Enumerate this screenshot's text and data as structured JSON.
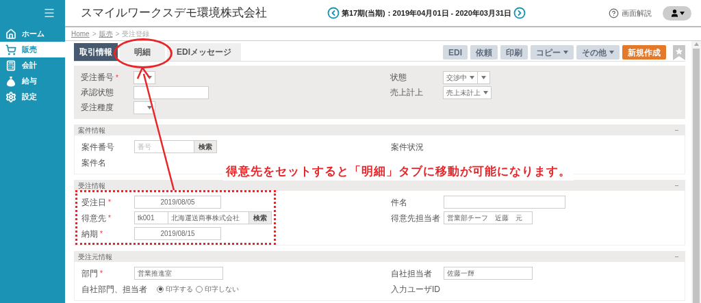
{
  "sidebar": {
    "items": [
      {
        "label": "ホーム",
        "selected": false
      },
      {
        "label": "販売",
        "selected": true
      },
      {
        "label": "会計",
        "selected": false
      },
      {
        "label": "給与",
        "selected": false
      },
      {
        "label": "設定",
        "selected": false
      }
    ]
  },
  "header": {
    "company": "スマイルワークスデモ環境株式会社",
    "period": "第17期(当期)：2019年04月01日 - 2020年03月31日",
    "help": "画面解説"
  },
  "breadcrumb": [
    {
      "label": "Home",
      "kind": "link"
    },
    {
      "label": ">",
      "kind": "separator"
    },
    {
      "label": "販売",
      "kind": "link"
    },
    {
      "label": ">",
      "kind": "separator"
    },
    {
      "label": "受注登録",
      "kind": "current"
    }
  ],
  "tabs": [
    {
      "label": "取引情報",
      "selected": true
    },
    {
      "label": "明細",
      "selected": false
    },
    {
      "label": "EDIメッセージ",
      "selected": false
    }
  ],
  "toolbar": [
    {
      "label": "EDI",
      "kind": "plain",
      "disabled": true
    },
    {
      "label": "依頼",
      "kind": "plain",
      "disabled": true
    },
    {
      "label": "印刷",
      "kind": "plain",
      "disabled": true
    },
    {
      "label": "コピー",
      "kind": "dropdown",
      "disabled": true
    },
    {
      "label": "その他",
      "kind": "dropdown",
      "disabled": true
    },
    {
      "label": "新規作成",
      "kind": "primary",
      "disabled": false
    }
  ],
  "header_panel": {
    "left": [
      {
        "label": "受注番号",
        "required_mark": "*",
        "kind": "select"
      },
      {
        "label": "承認状態",
        "kind": "input",
        "disabled": true
      },
      {
        "label": "受注種度",
        "kind": "select"
      }
    ],
    "right": [
      {
        "label": "状態",
        "kind": "double-select",
        "value": "交渉中"
      },
      {
        "label": "売上計上",
        "kind": "select",
        "value": "売上未計上"
      }
    ]
  },
  "sections": [
    {
      "title": "案件情報",
      "left": [
        {
          "label": "案件番号",
          "kind": "search-input",
          "placeholder": "番号",
          "button": "検索"
        },
        {
          "label": "案件名",
          "kind": "none"
        }
      ],
      "right": [
        {
          "label": "案件状況",
          "kind": "none"
        }
      ]
    },
    {
      "title": "受注情報",
      "left": [
        {
          "label": "受注日",
          "required_mark": "*",
          "kind": "date",
          "value": "2019/08/05"
        },
        {
          "label": "得意先",
          "required_mark": "*",
          "kind": "customer",
          "code": "tk001",
          "value": "北海運送商事株式会社",
          "button": "検索"
        },
        {
          "label": "納期",
          "required_mark": "*",
          "kind": "date",
          "value": "2019/08/15"
        }
      ],
      "right": [
        {
          "label": "件名",
          "kind": "wide-input"
        },
        {
          "label": "得意先担当者",
          "kind": "input",
          "value": "営業部チーフ　近藤　元"
        }
      ]
    },
    {
      "title": "受注元情報",
      "left": [
        {
          "label": "部門",
          "required_mark": "*",
          "kind": "input",
          "value": "営業推進室"
        },
        {
          "label": "自社部門、担当者",
          "kind": "radio",
          "options": [
            {
              "label": "印字する",
              "selected": true
            },
            {
              "label": "印字しない",
              "selected": false
            }
          ]
        }
      ],
      "right": [
        {
          "label": "自社担当者",
          "kind": "input",
          "value": "佐藤一輝"
        },
        {
          "label": "入力ユーザID",
          "kind": "none"
        }
      ]
    }
  ],
  "annotation": {
    "text": "得意先をセットすると「明細」タブに移動が可能になります。"
  }
}
